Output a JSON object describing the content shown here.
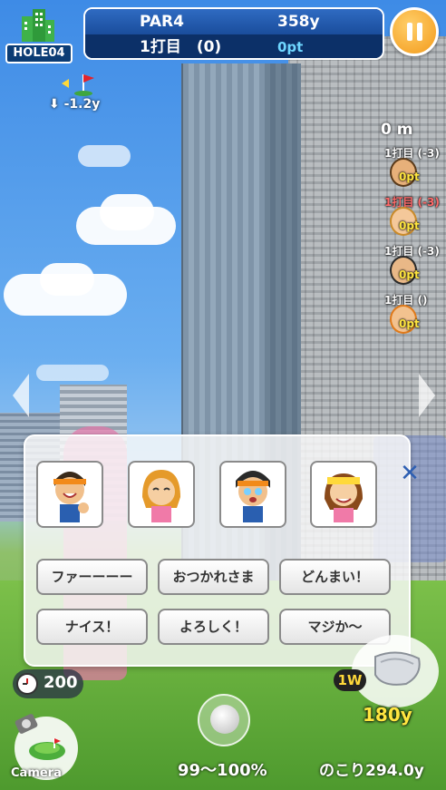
{
  "hud": {
    "hole_label": "HOLE04",
    "par": "PAR4",
    "distance": "358y",
    "shot": "1打目　(0)",
    "points": "0pt",
    "wind": "-1.2y"
  },
  "players_panel": {
    "distance": "0 m",
    "players": [
      {
        "status": "1打目 (-3)",
        "points": "0pt",
        "status_color": "#ffffff"
      },
      {
        "status": "1打目 (-3)",
        "points": "0pt",
        "status_color": "#ff6a6a"
      },
      {
        "status": "1打目 (-3)",
        "points": "0pt",
        "status_color": "#ffffff"
      },
      {
        "status": "1打目 ()",
        "points": "0pt",
        "status_color": "#ffffff"
      }
    ]
  },
  "chat": {
    "stamps": [
      "boy-cheer-stamp",
      "girl-bow-stamp",
      "boy-surprised-stamp",
      "girl-happy-stamp"
    ],
    "messages": [
      "ファーーーー",
      "おつかれさま",
      "どんまい！",
      "ナイス！",
      "よろしく！",
      "マジか～"
    ]
  },
  "bottom": {
    "timer": "200",
    "camera_label": "Camera",
    "power": "99～100%",
    "remaining": "のこり294.0y",
    "club": "1W",
    "club_distance": "180y"
  },
  "colors": {
    "hud_blue": "#0d3e82",
    "accent_yellow": "#ffe640",
    "pause_orange": "#f39a1a"
  }
}
